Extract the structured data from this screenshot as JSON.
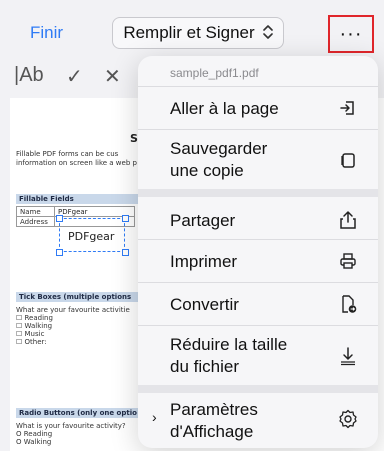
{
  "nav": {
    "finir": "Finir",
    "mode": "Remplir et Signer",
    "mode_chevron": "⌃⌄",
    "more": "···"
  },
  "tools": [
    {
      "name": "text-tool",
      "glyph": "|Ab"
    },
    {
      "name": "check-tool",
      "glyph": "✓"
    },
    {
      "name": "cross-tool",
      "glyph": "✕"
    }
  ],
  "pdf": {
    "title_fragment": "Sa",
    "intro_line1": "Fillable PDF forms can be cus",
    "intro_line2": "information on screen like a web p",
    "section1": "Fillable Fields",
    "row1_label": "Name",
    "row1_value": "PDFgear",
    "row2_label": "Address",
    "row2_value": "",
    "selected_text": "PDFgear",
    "section2": "Tick Boxes (multiple options",
    "q1": "What are your favourite activitie",
    "opt1": "☐ Reading",
    "opt2": "☐ Walking",
    "opt3": "☐ Music",
    "opt4": "☐ Other:",
    "section3": "Radio Buttons (only one optio",
    "q2": "What is your favourite activity?",
    "r1": "O Reading",
    "r2": "O Walking"
  },
  "menu": {
    "file_name": "sample_pdf1.pdf",
    "items": [
      {
        "label": "Aller à la page",
        "icon": "go-to-page-icon"
      },
      {
        "label": "Sauvegarder\nune copie",
        "icon": "copy-document-icon"
      },
      {
        "label": "Partager",
        "icon": "share-icon"
      },
      {
        "label": "Imprimer",
        "icon": "printer-icon"
      },
      {
        "label": "Convertir",
        "icon": "convert-file-icon"
      },
      {
        "label": "Réduire la taille\ndu fichier",
        "icon": "download-reduce-icon"
      },
      {
        "label": "Paramètres\nd'Affichage",
        "icon": "gear-icon"
      }
    ],
    "settings_chevron": "›"
  }
}
